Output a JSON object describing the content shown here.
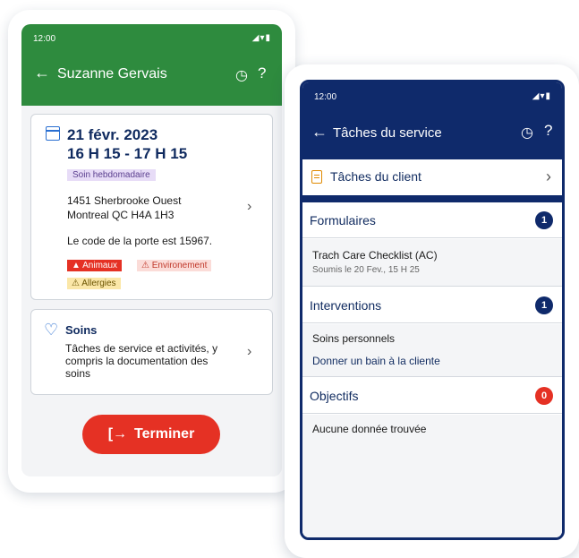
{
  "left_phone": {
    "status_time": "12:00",
    "status_icons": "◢▾▮",
    "title": "Suzanne Gervais",
    "visit": {
      "date": "21 févr. 2023",
      "time": "16 H 15 - 17 H 15",
      "tag": "Soin hebdomadaire",
      "address_line1": "1451 Sherbrooke Ouest",
      "address_line2": "Montreal QC H4A 1H3",
      "door_code": "Le code de la porte est 15967.",
      "alerts": [
        "Animaux",
        "Environement",
        "Allergies"
      ]
    },
    "soins": {
      "title": "Soins",
      "description": "Tâches de service et activités, y compris la documentation des soins"
    },
    "terminate_label": "Terminer"
  },
  "right_phone": {
    "status_time": "12:00",
    "status_icons": "◢▾▮",
    "title": "Tâches du service",
    "client_tasks_label": "Tâches du client",
    "sections": [
      {
        "title": "Formulaires",
        "count": "1",
        "items": [
          "Trach Care Checklist (AC)"
        ],
        "sub": "Soumis le 20 Fev., 15 H 25"
      },
      {
        "title": "Interventions",
        "count": "1",
        "items": [
          "Soins personnels",
          "Donner un bain à la cliente"
        ]
      },
      {
        "title": "Objectifs",
        "count": "0",
        "items": [
          "Aucune donnée trouvée"
        ]
      }
    ]
  },
  "colors": {
    "green": "#2e8b3e",
    "navy": "#0f2a6b",
    "red": "#e53124"
  }
}
